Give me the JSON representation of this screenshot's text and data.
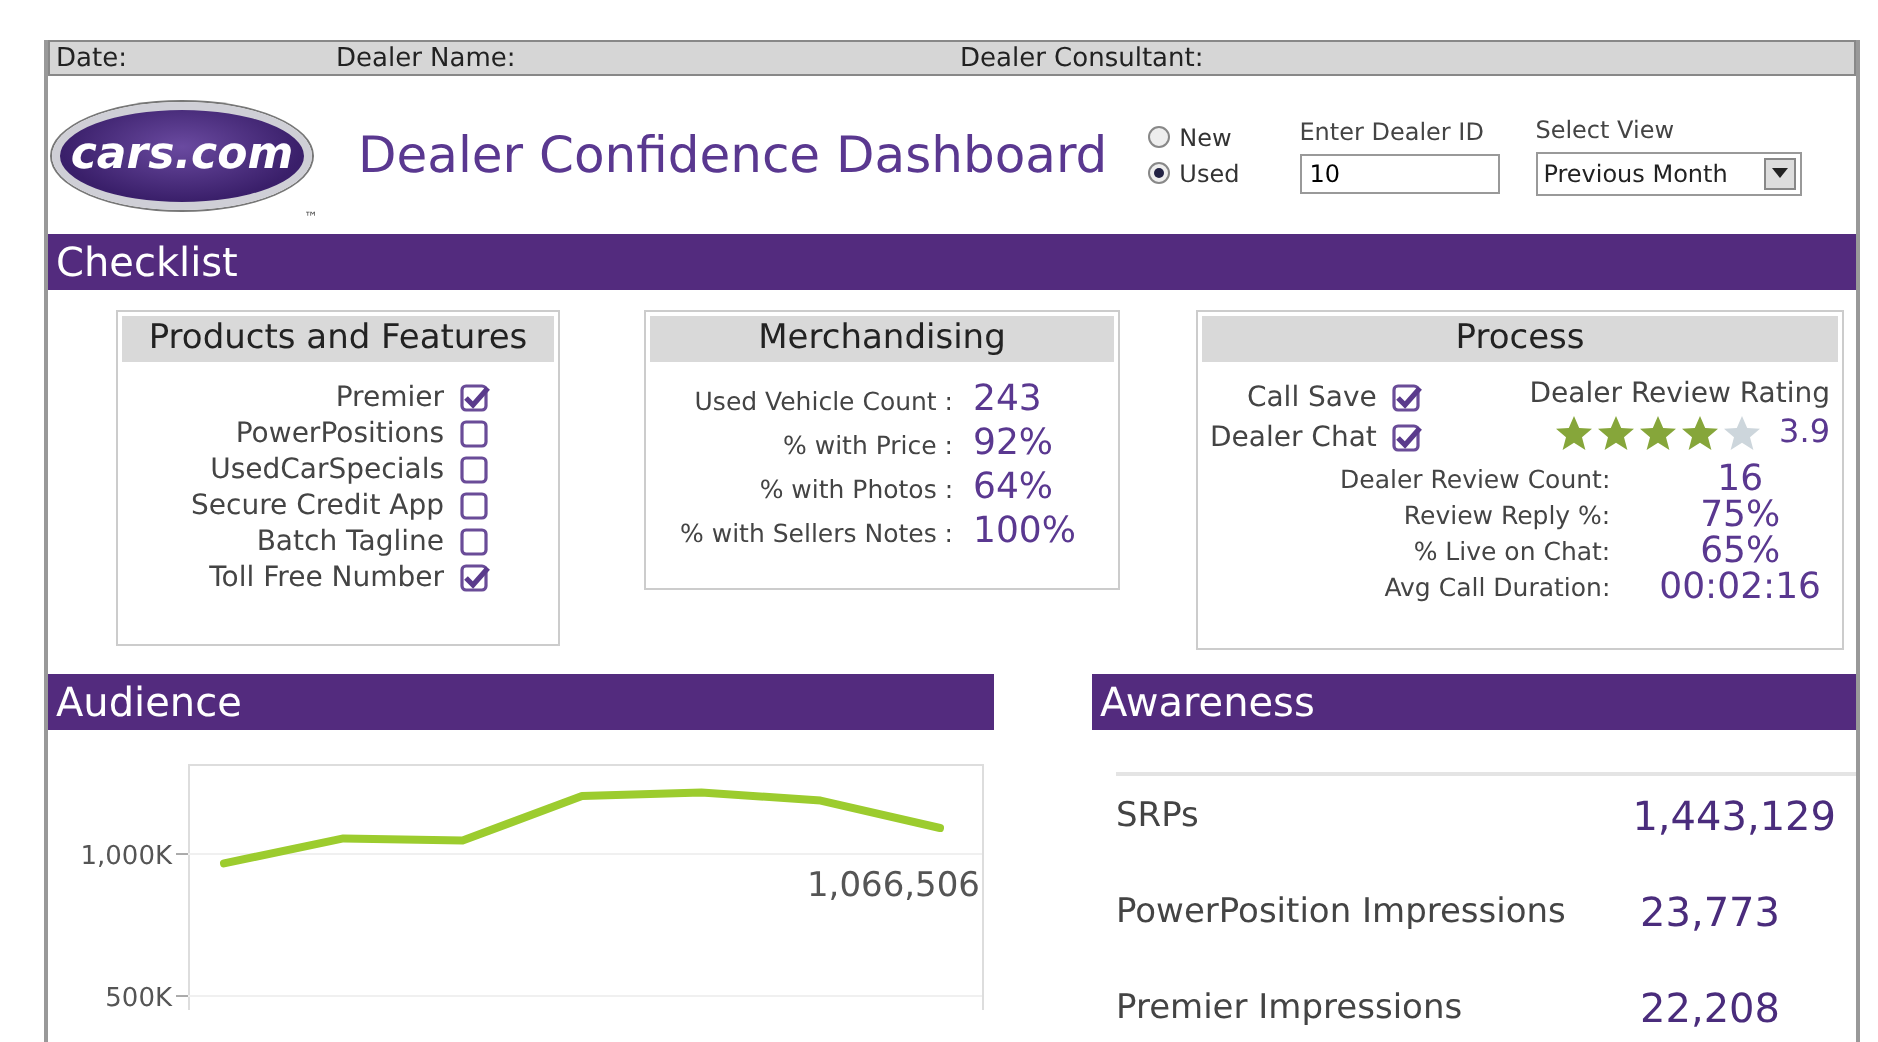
{
  "top_bar": {
    "fields": [
      {
        "label": "Date:"
      },
      {
        "label": "Dealer Name:"
      },
      {
        "label": "Dealer Consultant:"
      }
    ]
  },
  "header": {
    "logo": "cars.com",
    "logo_mark": "™",
    "title": "Dealer Confidence Dashboard",
    "inventory_type": [
      {
        "label": "New",
        "selected": false
      },
      {
        "label": "Used",
        "selected": true
      }
    ],
    "dealer_id": {
      "label": "Enter Dealer ID",
      "value": "10"
    },
    "view": {
      "label": "Select View",
      "value": "Previous Month"
    }
  },
  "checklist": {
    "title": "Checklist",
    "products": {
      "title": "Products and Features",
      "items": [
        {
          "label": "Premier",
          "checked": true
        },
        {
          "label": "PowerPositions",
          "checked": false
        },
        {
          "label": "UsedCarSpecials",
          "checked": false
        },
        {
          "label": "Secure Credit App",
          "checked": false
        },
        {
          "label": "Batch Tagline",
          "checked": false
        },
        {
          "label": "Toll Free Number",
          "checked": true
        }
      ]
    },
    "merchandising": {
      "title": "Merchandising",
      "rows": [
        {
          "label": "Used Vehicle Count :",
          "value": "243"
        },
        {
          "label": "% with Price :",
          "value": "92%"
        },
        {
          "label": "% with Photos :",
          "value": "64%"
        },
        {
          "label": "% with Sellers Notes :",
          "value": "100%"
        }
      ]
    },
    "process": {
      "title": "Process",
      "checks": [
        {
          "label": "Call Save",
          "checked": true
        },
        {
          "label": "Dealer Chat",
          "checked": true
        }
      ],
      "rating": {
        "label": "Dealer Review Rating",
        "stars": 4,
        "value": "3.9"
      },
      "rows": [
        {
          "label": "Dealer Review Count:",
          "value": "16"
        },
        {
          "label": "Review Reply %:",
          "value": "75%"
        },
        {
          "label": "% Live on Chat:",
          "value": "65%"
        },
        {
          "label": "Avg Call Duration:",
          "value": "00:02:16"
        }
      ]
    }
  },
  "audience": {
    "title": "Audience",
    "chart_data": {
      "type": "line",
      "series": [
        {
          "color": "#9ccc2e",
          "values": [
            967,
            1055,
            1047,
            1204,
            1217,
            1188,
            1092
          ]
        }
      ],
      "ylim": [
        328,
        1317
      ],
      "yticks": [
        {
          "value": 500,
          "label": "500K"
        },
        {
          "value": 1000,
          "label": "1,000K"
        }
      ],
      "annotations": [
        "1,066,506"
      ]
    }
  },
  "awareness": {
    "title": "Awareness",
    "rows": [
      {
        "label": "SRPs",
        "value": "1,443,129"
      },
      {
        "label": "PowerPosition Impressions",
        "value": "23,773"
      },
      {
        "label": "Premier Impressions",
        "value": "22,208"
      }
    ]
  }
}
